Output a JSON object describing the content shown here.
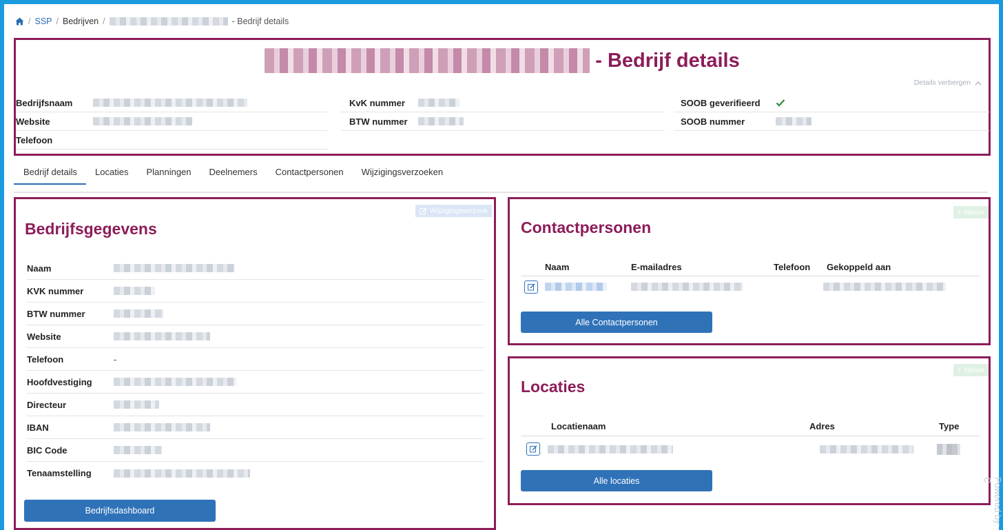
{
  "breadcrumb": {
    "items": [
      "SSP",
      "Bedrijven"
    ],
    "current_suffix": "- Bedrijf details"
  },
  "header": {
    "title_suffix": "- Bedrijf details",
    "toggle_label": "Details verbergen",
    "fields": {
      "bedrijfsnaam": "Bedrijfsnaam",
      "website": "Website",
      "telefoon": "Telefoon",
      "kvk": "KvK nummer",
      "btw": "BTW nummer",
      "soob_geverifieerd": "SOOB geverifieerd",
      "soob_nummer": "SOOB nummer"
    }
  },
  "tabs": [
    "Bedrijf details",
    "Locaties",
    "Planningen",
    "Deelnemers",
    "Contactpersonen",
    "Wijzigingsverzoeken"
  ],
  "company_panel": {
    "title": "Bedrijfsgegevens",
    "change_request_label": "Wijzigingsverzoek",
    "rows": [
      {
        "label": "Naam",
        "value": ""
      },
      {
        "label": "KVK nummer",
        "value": ""
      },
      {
        "label": "BTW nummer",
        "value": ""
      },
      {
        "label": "Website",
        "value": ""
      },
      {
        "label": "Telefoon",
        "value": "-"
      },
      {
        "label": "Hoofdvestiging",
        "value": ""
      },
      {
        "label": "Directeur",
        "value": ""
      },
      {
        "label": "IBAN",
        "value": ""
      },
      {
        "label": "BIC Code",
        "value": ""
      },
      {
        "label": "Tenaamstelling",
        "value": ""
      }
    ],
    "dashboard_button": "Bedrijfsdashboard"
  },
  "contacts_panel": {
    "title": "Contactpersonen",
    "new_label": "Nieuw",
    "columns": [
      "Naam",
      "E-mailadres",
      "Telefoon",
      "Gekoppeld aan"
    ],
    "all_button": "Alle Contactpersonen"
  },
  "locations_panel": {
    "title": "Locaties",
    "new_label": "Nieuw",
    "columns": [
      "Locatienaam",
      "Adres",
      "Type"
    ],
    "all_button": "Alle locaties"
  },
  "watermark": "Powered by: C",
  "colors": {
    "accent": "#8c1d59",
    "primary": "#2f72b8",
    "frame": "#1a9be0",
    "success": "#2e8b3a"
  }
}
